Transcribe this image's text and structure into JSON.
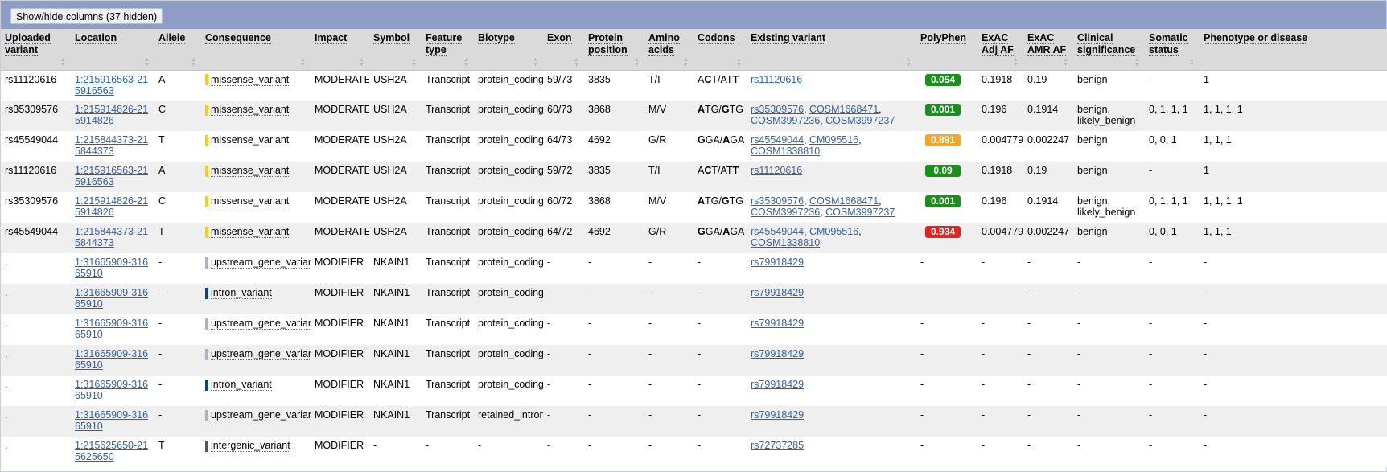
{
  "toolbar": {
    "toggle_label": "Show/hide columns (37 hidden)"
  },
  "colors": {
    "header_band": "#8e9dc6",
    "link": "#2f5fa7",
    "moderate": "#f5d00f",
    "modifier_upstream": "#a3b4cb",
    "modifier_intron": "#06467a",
    "intergenic": "#555555",
    "pp_benign": "#1a8f1a",
    "pp_possibly": "#f5a623",
    "pp_probably": "#e52321"
  },
  "columns": [
    {
      "label": "Uploaded variant"
    },
    {
      "label": "Location"
    },
    {
      "label": "Allele"
    },
    {
      "label": "Consequence"
    },
    {
      "label": "Impact"
    },
    {
      "label": "Symbol"
    },
    {
      "label": "Feature type"
    },
    {
      "label": "Biotype"
    },
    {
      "label": "Exon"
    },
    {
      "label": "Protein position"
    },
    {
      "label": "Amino acids"
    },
    {
      "label": "Codons"
    },
    {
      "label": "Existing variant"
    },
    {
      "label": "PolyPhen"
    },
    {
      "label": "ExAC Adj AF"
    },
    {
      "label": "ExAC AMR AF"
    },
    {
      "label": "Clinical significance"
    },
    {
      "label": "Somatic status"
    },
    {
      "label": "Phenotype or disease"
    }
  ],
  "rows": [
    {
      "uploaded": "rs11120616",
      "location": "1:215916563-215916563",
      "allele": "A",
      "consequence": "missense_variant",
      "csq_color": "#f5d00f",
      "impact": "MODERATE",
      "symbol": "USH2A",
      "feature_type": "Transcript",
      "biotype": "protein_coding",
      "exon": "59/73",
      "protein_pos": "3835",
      "amino": "T/I",
      "codon_a": "A",
      "codon_b": "C",
      "codon_c": "T/AT",
      "codon_d": "T",
      "codon_e": "",
      "existing": [
        "rs11120616"
      ],
      "polyphen": "0.054",
      "pp_color": "#1a8f1a",
      "exac_adj": "0.1918",
      "exac_amr": "0.19",
      "clin": "benign",
      "somatic": "-",
      "pheno": "1"
    },
    {
      "uploaded": "rs35309576",
      "location": "1:215914826-215914826",
      "allele": "C",
      "consequence": "missense_variant",
      "csq_color": "#f5d00f",
      "impact": "MODERATE",
      "symbol": "USH2A",
      "feature_type": "Transcript",
      "biotype": "protein_coding",
      "exon": "60/73",
      "protein_pos": "3868",
      "amino": "M/V",
      "codon_a": "",
      "codon_b": "A",
      "codon_c": "TG/",
      "codon_d": "G",
      "codon_e": "TG",
      "existing": [
        "rs35309576",
        "COSM1668471",
        "COSM3997236",
        "COSM3997237"
      ],
      "polyphen": "0.001",
      "pp_color": "#1a8f1a",
      "exac_adj": "0.196",
      "exac_amr": "0.1914",
      "clin": "benign, likely_benign",
      "somatic": "0, 1, 1, 1",
      "pheno": "1, 1, 1, 1"
    },
    {
      "uploaded": "rs45549044",
      "location": "1:215844373-215844373",
      "allele": "T",
      "consequence": "missense_variant",
      "csq_color": "#f5d00f",
      "impact": "MODERATE",
      "symbol": "USH2A",
      "feature_type": "Transcript",
      "biotype": "protein_coding",
      "exon": "64/73",
      "protein_pos": "4692",
      "amino": "G/R",
      "codon_a": "",
      "codon_b": "G",
      "codon_c": "GA/",
      "codon_d": "A",
      "codon_e": "GA",
      "existing": [
        "rs45549044",
        "CM095516",
        "COSM1338810"
      ],
      "polyphen": "0.891",
      "pp_color": "#f5a623",
      "exac_adj": "0.004779",
      "exac_amr": "0.002247",
      "clin": "benign",
      "somatic": "0, 0, 1",
      "pheno": "1, 1, 1"
    },
    {
      "uploaded": "rs11120616",
      "location": "1:215916563-215916563",
      "allele": "A",
      "consequence": "missense_variant",
      "csq_color": "#f5d00f",
      "impact": "MODERATE",
      "symbol": "USH2A",
      "feature_type": "Transcript",
      "biotype": "protein_coding",
      "exon": "59/72",
      "protein_pos": "3835",
      "amino": "T/I",
      "codon_a": "A",
      "codon_b": "C",
      "codon_c": "T/AT",
      "codon_d": "T",
      "codon_e": "",
      "existing": [
        "rs11120616"
      ],
      "polyphen": "0.09",
      "pp_color": "#1a8f1a",
      "exac_adj": "0.1918",
      "exac_amr": "0.19",
      "clin": "benign",
      "somatic": "-",
      "pheno": "1"
    },
    {
      "uploaded": "rs35309576",
      "location": "1:215914826-215914826",
      "allele": "C",
      "consequence": "missense_variant",
      "csq_color": "#f5d00f",
      "impact": "MODERATE",
      "symbol": "USH2A",
      "feature_type": "Transcript",
      "biotype": "protein_coding",
      "exon": "60/72",
      "protein_pos": "3868",
      "amino": "M/V",
      "codon_a": "",
      "codon_b": "A",
      "codon_c": "TG/",
      "codon_d": "G",
      "codon_e": "TG",
      "existing": [
        "rs35309576",
        "COSM1668471",
        "COSM3997236",
        "COSM3997237"
      ],
      "polyphen": "0.001",
      "pp_color": "#1a8f1a",
      "exac_adj": "0.196",
      "exac_amr": "0.1914",
      "clin": "benign, likely_benign",
      "somatic": "0, 1, 1, 1",
      "pheno": "1, 1, 1, 1"
    },
    {
      "uploaded": "rs45549044",
      "location": "1:215844373-215844373",
      "allele": "T",
      "consequence": "missense_variant",
      "csq_color": "#f5d00f",
      "impact": "MODERATE",
      "symbol": "USH2A",
      "feature_type": "Transcript",
      "biotype": "protein_coding",
      "exon": "64/72",
      "protein_pos": "4692",
      "amino": "G/R",
      "codon_a": "",
      "codon_b": "G",
      "codon_c": "GA/",
      "codon_d": "A",
      "codon_e": "GA",
      "existing": [
        "rs45549044",
        "CM095516",
        "COSM1338810"
      ],
      "polyphen": "0.934",
      "pp_color": "#e52321",
      "exac_adj": "0.004779",
      "exac_amr": "0.002247",
      "clin": "benign",
      "somatic": "0, 0, 1",
      "pheno": "1, 1, 1"
    },
    {
      "uploaded": ".",
      "location": "1:31665909-31665910",
      "allele": "-",
      "consequence": "upstream_gene_variant",
      "csq_color": "#a3b4cb",
      "impact": "MODIFIER",
      "symbol": "NKAIN1",
      "feature_type": "Transcript",
      "biotype": "protein_coding",
      "exon": "-",
      "protein_pos": "-",
      "amino": "-",
      "codon_plain": "-",
      "existing": [
        "rs79918429"
      ],
      "polyphen": "-",
      "exac_adj": "-",
      "exac_amr": "-",
      "clin": "-",
      "somatic": "-",
      "pheno": "-"
    },
    {
      "uploaded": ".",
      "location": "1:31665909-31665910",
      "allele": "-",
      "consequence": "intron_variant",
      "csq_color": "#06467a",
      "impact": "MODIFIER",
      "symbol": "NKAIN1",
      "feature_type": "Transcript",
      "biotype": "protein_coding",
      "exon": "-",
      "protein_pos": "-",
      "amino": "-",
      "codon_plain": "-",
      "existing": [
        "rs79918429"
      ],
      "polyphen": "-",
      "exac_adj": "-",
      "exac_amr": "-",
      "clin": "-",
      "somatic": "-",
      "pheno": "-"
    },
    {
      "uploaded": ".",
      "location": "1:31665909-31665910",
      "allele": "-",
      "consequence": "upstream_gene_variant",
      "csq_color": "#a3b4cb",
      "impact": "MODIFIER",
      "symbol": "NKAIN1",
      "feature_type": "Transcript",
      "biotype": "protein_coding",
      "exon": "-",
      "protein_pos": "-",
      "amino": "-",
      "codon_plain": "-",
      "existing": [
        "rs79918429"
      ],
      "polyphen": "-",
      "exac_adj": "-",
      "exac_amr": "-",
      "clin": "-",
      "somatic": "-",
      "pheno": "-"
    },
    {
      "uploaded": ".",
      "location": "1:31665909-31665910",
      "allele": "-",
      "consequence": "upstream_gene_variant",
      "csq_color": "#a3b4cb",
      "impact": "MODIFIER",
      "symbol": "NKAIN1",
      "feature_type": "Transcript",
      "biotype": "protein_coding",
      "exon": "-",
      "protein_pos": "-",
      "amino": "-",
      "codon_plain": "-",
      "existing": [
        "rs79918429"
      ],
      "polyphen": "-",
      "exac_adj": "-",
      "exac_amr": "-",
      "clin": "-",
      "somatic": "-",
      "pheno": "-"
    },
    {
      "uploaded": ".",
      "location": "1:31665909-31665910",
      "allele": "-",
      "consequence": "intron_variant",
      "csq_color": "#06467a",
      "impact": "MODIFIER",
      "symbol": "NKAIN1",
      "feature_type": "Transcript",
      "biotype": "protein_coding",
      "exon": "-",
      "protein_pos": "-",
      "amino": "-",
      "codon_plain": "-",
      "existing": [
        "rs79918429"
      ],
      "polyphen": "-",
      "exac_adj": "-",
      "exac_amr": "-",
      "clin": "-",
      "somatic": "-",
      "pheno": "-"
    },
    {
      "uploaded": ".",
      "location": "1:31665909-31665910",
      "allele": "-",
      "consequence": "upstream_gene_variant",
      "csq_color": "#a3b4cb",
      "impact": "MODIFIER",
      "symbol": "NKAIN1",
      "feature_type": "Transcript",
      "biotype": "retained_intron",
      "exon": "-",
      "protein_pos": "-",
      "amino": "-",
      "codon_plain": "-",
      "existing": [
        "rs79918429"
      ],
      "polyphen": "-",
      "exac_adj": "-",
      "exac_amr": "-",
      "clin": "-",
      "somatic": "-",
      "pheno": "-"
    },
    {
      "uploaded": ".",
      "location": "1:215625650-215625650",
      "allele": "T",
      "consequence": "intergenic_variant",
      "csq_color": "#555555",
      "impact": "MODIFIER",
      "symbol": "-",
      "feature_type": "-",
      "biotype": "-",
      "exon": "-",
      "protein_pos": "-",
      "amino": "-",
      "codon_plain": "-",
      "existing": [
        "rs72737285"
      ],
      "polyphen": "-",
      "exac_adj": "-",
      "exac_amr": "-",
      "clin": "-",
      "somatic": "-",
      "pheno": "-"
    }
  ]
}
